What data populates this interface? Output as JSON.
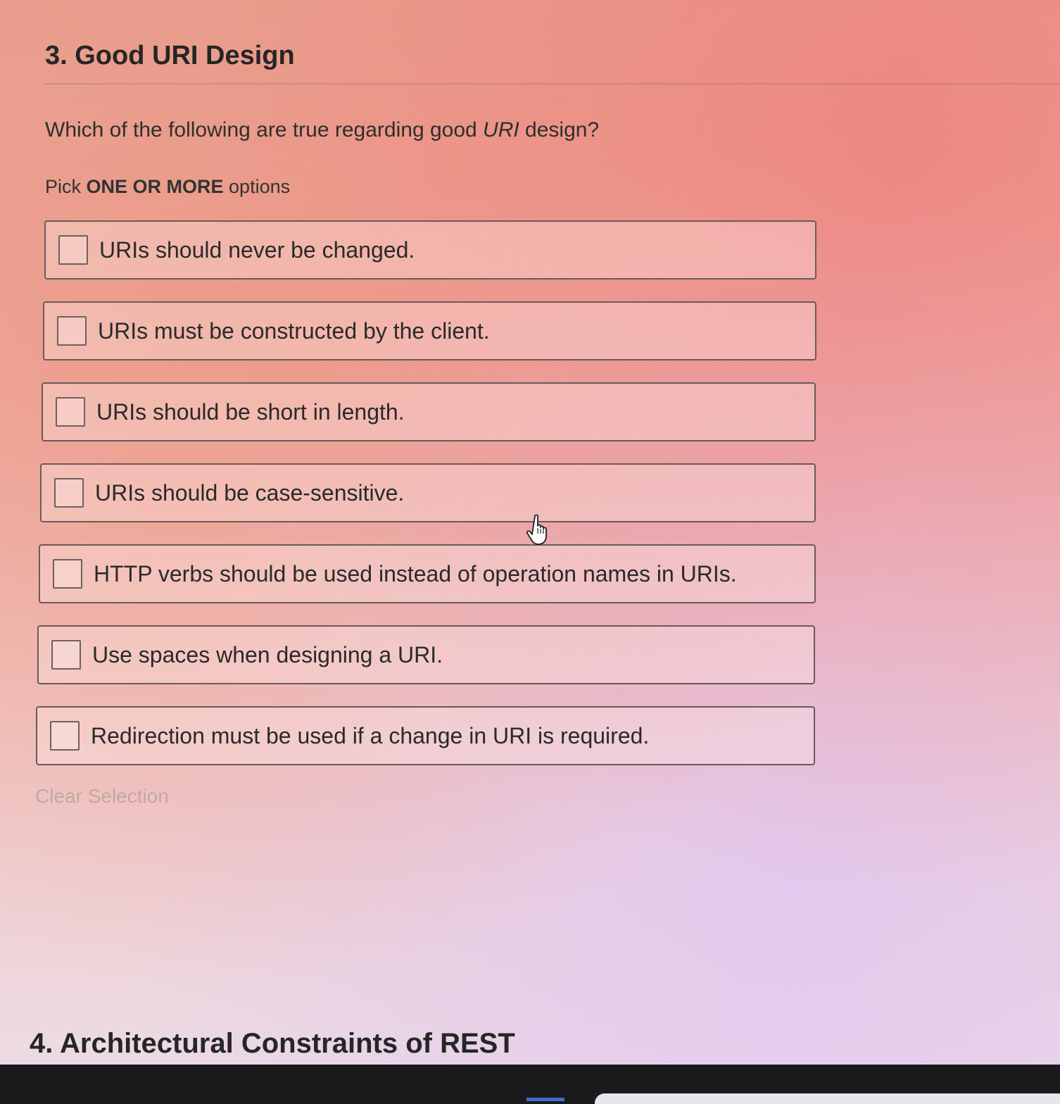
{
  "question": {
    "title": "3. Good URI Design",
    "prompt_before": "Which of the following are true regarding good ",
    "prompt_em": "URI",
    "prompt_after": " design?",
    "instruction_before": "Pick ",
    "instruction_bold": "ONE OR MORE",
    "instruction_after": " options",
    "options": [
      {
        "label": "URIs should never be changed.",
        "checked": false
      },
      {
        "label": "URIs must be constructed by the client.",
        "checked": false
      },
      {
        "label": "URIs should be short in length.",
        "checked": false
      },
      {
        "label": "URIs should be case-sensitive.",
        "checked": false
      },
      {
        "label": "HTTP verbs should be used instead of operation names in URIs.",
        "checked": false
      },
      {
        "label": "Use spaces when designing a URI.",
        "checked": false
      },
      {
        "label": "Redirection must be used if a change in URI is required.",
        "checked": false
      }
    ],
    "clear_selection": "Clear Selection"
  },
  "next_question": {
    "title": "4. Architectural Constraints of REST"
  },
  "cursor": {
    "icon": "hand-pointer-icon"
  }
}
